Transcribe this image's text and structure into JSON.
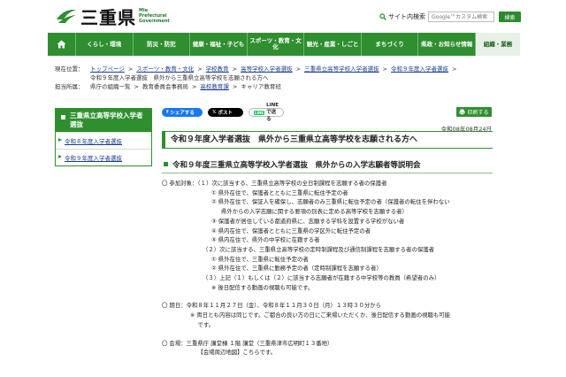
{
  "header": {
    "logo_text": "三重県",
    "logo_en": [
      "Mie",
      "Prefectural",
      "Government"
    ],
    "search_label": "サイト内検索",
    "search_placeholder": "Google™カスタム検索",
    "search_button": "検索"
  },
  "nav": {
    "items": [
      "くらし・環境",
      "防災・防犯",
      "健康・福祉・子ども",
      "スポーツ・教育・文化",
      "観光・産業・しごと",
      "まちづくり",
      "県政・お知らせ情報",
      "組織・業務"
    ]
  },
  "breadcrumbs": {
    "current_label": "現在位置：",
    "current": [
      "トップページ",
      "スポーツ・教育・文化",
      "学校教育",
      "高等学校入学者選抜",
      "三重県立高等学校入学者選抜",
      "令和９年度入学者選抜"
    ],
    "current_last": "令和９年度入学者選抜　県外から三重県立高等学校を志願される方へ",
    "owner_label": "担当所属：",
    "owner": [
      "県庁の組織一覧",
      "教育委員会事務局",
      "高校教育課",
      "キャリア教育班"
    ]
  },
  "sidebar": {
    "title": "三重県立高等学校入学者選抜",
    "items": [
      "令和８年度入学者選抜",
      "令和９年度入学者選抜"
    ]
  },
  "share": {
    "facebook": "シェアする",
    "x": "ポスト",
    "line": "LINEで送る",
    "print": "印刷する"
  },
  "page": {
    "date": "令和08年08月24日",
    "title": "令和９年度入学者選抜　県外から三重県立高等学校を志願される方へ",
    "section_title": "令和９年度三重県立高等学校入学者選抜　県外からの入学志願者等説明会",
    "lines": [
      {
        "cls": "ind0",
        "text": "〇 参加対象：（１）次に該当する、三重県立高等学校の全日制課程を志願する者の保護者"
      },
      {
        "cls": "ind2",
        "text": "① 県外在住で、保護者とともに三重県に転住予定の者"
      },
      {
        "cls": "ind2",
        "text": "② 県外在住で、保証人を確保し、志願者のみ三重県に転住予定の者（保護者の転住を伴わない"
      },
      {
        "cls": "ind3",
        "text": "県外からの入学志願に関する要項の別表に定める高等学校を志願する者）"
      },
      {
        "cls": "ind2",
        "text": "③ 保護者が居住している都道府県に、志願する学科を設置する学校がない者"
      },
      {
        "cls": "ind2",
        "text": "④ 県内在住で、保護者とともに三重県の学区外に転住予定の者"
      },
      {
        "cls": "ind2",
        "text": "⑤ 県内在住で、県外の中学校に在籍する者"
      },
      {
        "cls": "ind1",
        "text": "（２）次に該当する、三重県立高等学校の定時制課程及び通信制課程を志願する者の保護者"
      },
      {
        "cls": "ind2",
        "text": "① 県外在住で、三重県に転住予定の者"
      },
      {
        "cls": "ind2",
        "text": "② 県外在住で、三重県に勤務予定の者（定時制課程を志願する者）"
      },
      {
        "cls": "ind1",
        "text": "（３）上記（１）もしくは（２）に該当する志願者が在籍する中学校等の教員（希望者のみ）"
      },
      {
        "cls": "ind2",
        "text": "※ 後日配信する動画の視聴も可能です。"
      },
      {
        "cls": "gap",
        "text": ""
      },
      {
        "cls": "ind0",
        "text": "〇 期日：令和８年１１月２７日（金）、令和８年１１月３０日（月）１３時３０分から"
      },
      {
        "cls": "ind4",
        "text": "※ 両日とも内容は同じです。ご都合の良い方の日にご来場いただくか、後日配信する動画の視聴も可能"
      },
      {
        "cls": "ind4",
        "text": "　 です。"
      },
      {
        "cls": "gap",
        "text": ""
      },
      {
        "cls": "ind0",
        "text": "〇 会場：三重県庁 講堂棟 １階 講堂（三重県津市広明町１３番地）"
      },
      {
        "cls": "ind4",
        "text": "　 【会場周辺地図】こちらです。"
      }
    ]
  },
  "colors": {
    "brand_green": "#2f8f2f",
    "link_blue": "#1a3c8f",
    "facebook": "#1877f2",
    "x": "#000000",
    "line": "#06c755"
  }
}
